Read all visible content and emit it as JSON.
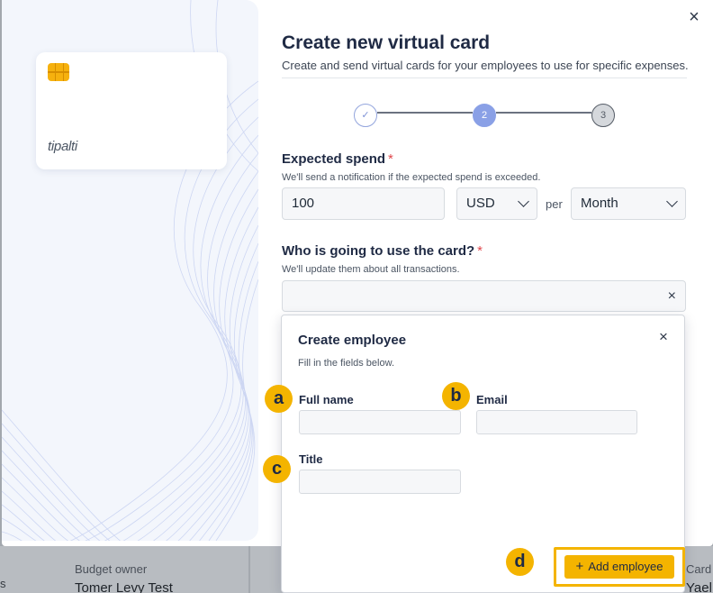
{
  "background": {
    "budget_owner_label": "Budget owner",
    "budget_owner_name": "Tomer Levy Test",
    "card_label": "Card",
    "card_name": "Yael",
    "left_edge_text": "s"
  },
  "card_preview": {
    "logo_text": "tipalti",
    "chip_icon": "card-chip-icon"
  },
  "modal": {
    "close_icon": "close-icon",
    "title": "Create new virtual card",
    "subtitle": "Create and send virtual cards for your employees to use for specific expenses.",
    "stepper": {
      "steps": [
        {
          "label": "✓",
          "state": "done"
        },
        {
          "label": "2",
          "state": "active"
        },
        {
          "label": "3",
          "state": "todo"
        }
      ]
    },
    "expected_spend": {
      "label": "Expected spend",
      "required_mark": "*",
      "help": "We'll send a notification if the expected spend is exceeded.",
      "amount_value": "100",
      "currency_value": "USD",
      "per_label": "per",
      "period_value": "Month"
    },
    "card_user": {
      "label": "Who is going to use the card?",
      "required_mark": "*",
      "help": "We'll update them about all transactions.",
      "value": "",
      "clear_icon": "×"
    }
  },
  "create_employee": {
    "title": "Create employee",
    "subtitle": "Fill in the fields below.",
    "close_icon": "×",
    "fields": {
      "full_name_label": "Full name",
      "full_name_value": "",
      "email_label": "Email",
      "email_value": "",
      "title_label": "Title",
      "title_value": ""
    },
    "add_button_icon": "+",
    "add_button_label": "Add employee"
  },
  "callouts": {
    "a": "a",
    "b": "b",
    "c": "c",
    "d": "d"
  },
  "colors": {
    "accent": "#f4b400",
    "step_active": "#8aa0e6",
    "required": "#e0474c"
  }
}
